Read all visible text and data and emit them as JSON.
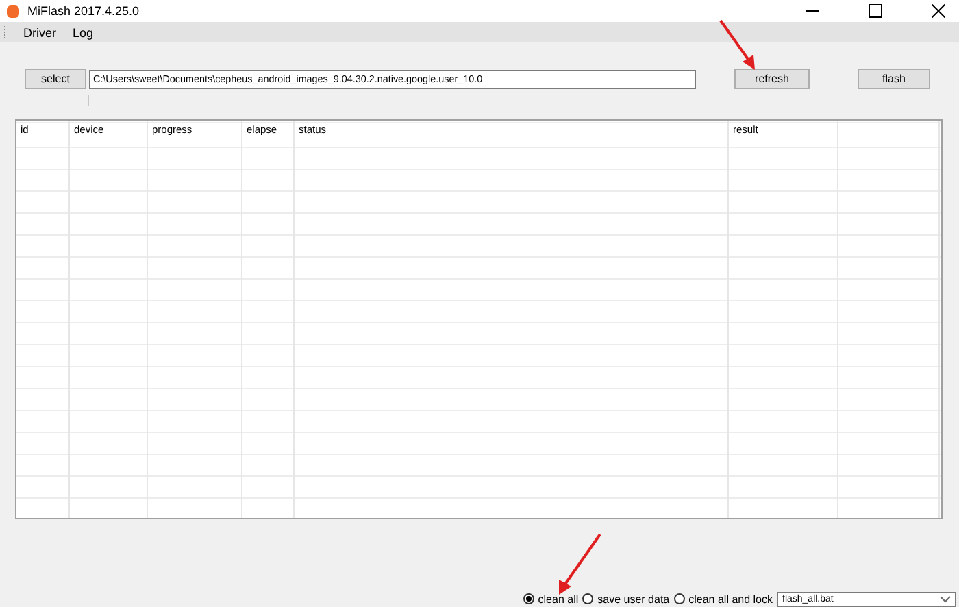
{
  "window": {
    "title": "MiFlash 2017.4.25.0"
  },
  "menu": [
    "Driver",
    "Log"
  ],
  "toolbar": {
    "select_button": "select",
    "path": "C:\\Users\\sweet\\Documents\\cepheus_android_images_9.04.30.2.native.google.user_10.0",
    "refresh_button": "refresh",
    "flash_button": "flash"
  },
  "table": {
    "columns": [
      "id",
      "device",
      "progress",
      "elapse",
      "status",
      "result"
    ]
  },
  "options": [
    {
      "label": "clean all",
      "selected": true
    },
    {
      "label": "save user data",
      "selected": false
    },
    {
      "label": "clean all and lock",
      "selected": false
    }
  ],
  "script": {
    "value": "flash_all.bat"
  }
}
